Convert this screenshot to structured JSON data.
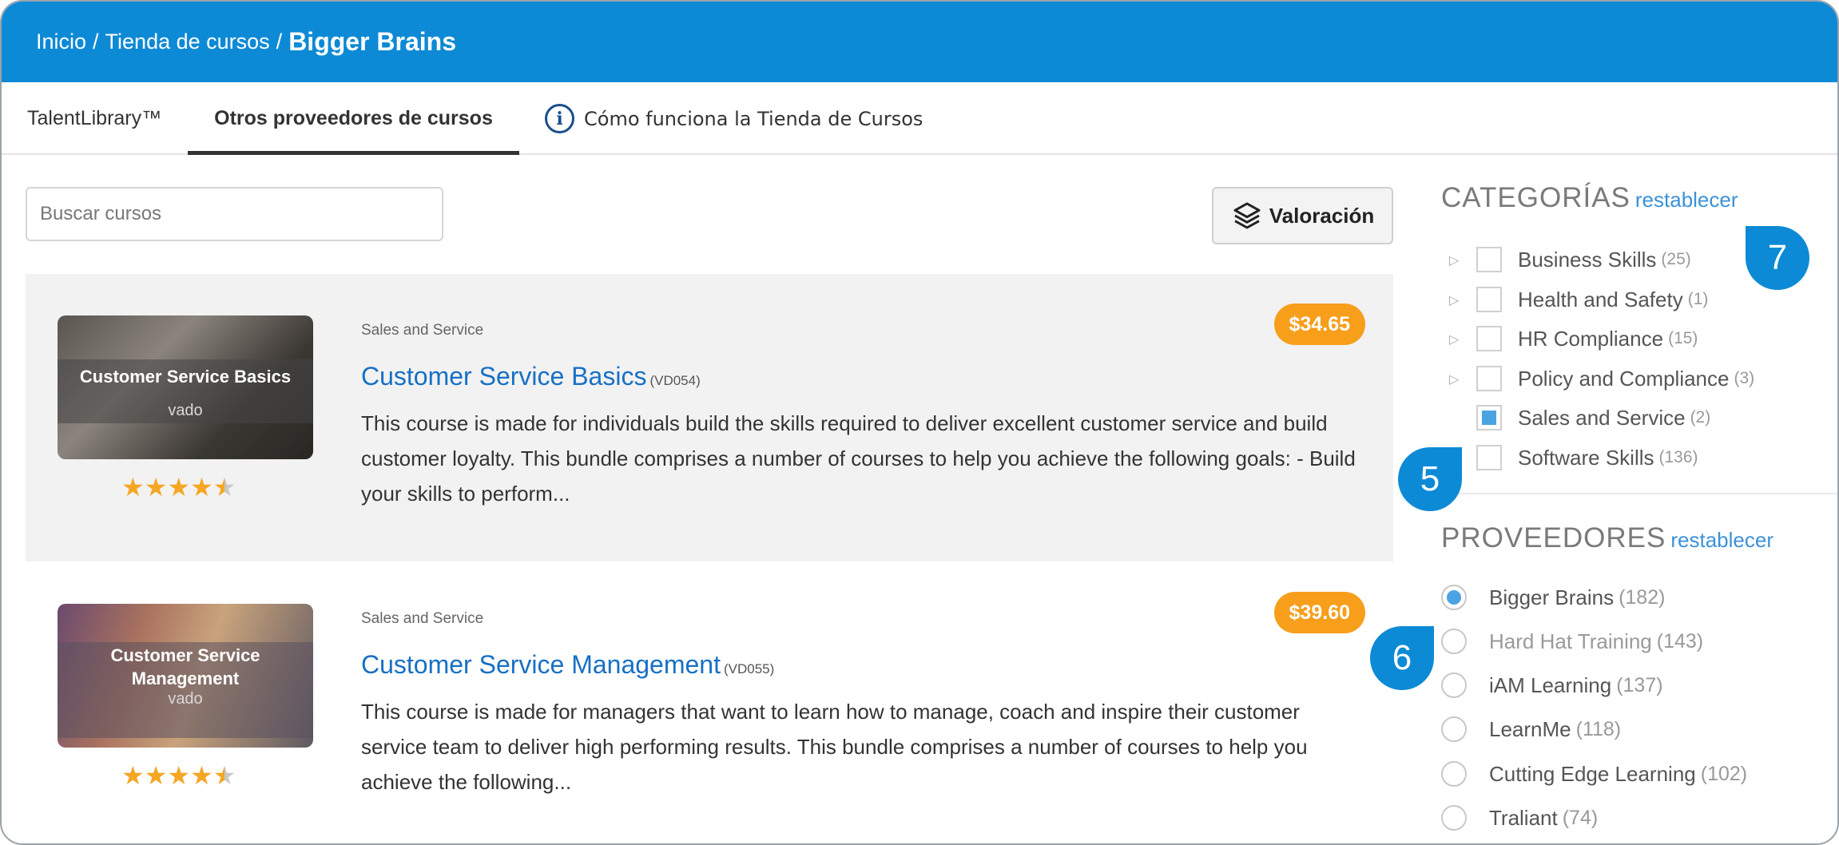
{
  "breadcrumb": {
    "items": [
      "Inicio",
      "Tienda de cursos"
    ],
    "separator": "/",
    "current": "Bigger Brains"
  },
  "tabs": [
    {
      "label": "TalentLibrary™",
      "active": false
    },
    {
      "label": "Otros proveedores de cursos",
      "active": true
    },
    {
      "label": "Cómo funciona la Tienda de Cursos",
      "active": false,
      "icon": "info-icon"
    }
  ],
  "search": {
    "placeholder": "Buscar cursos",
    "value": ""
  },
  "sort": {
    "label": "Valoración",
    "icon": "layers-icon"
  },
  "courses": [
    {
      "category": "Sales and Service",
      "title": "Customer Service Basics",
      "code": "(VD054)",
      "price": "$34.65",
      "thumb_title": "Customer Service Basics",
      "thumb_brand": "vado",
      "rating": 4.5,
      "description": "This course is made for individuals build the skills required to deliver excellent customer service and build customer loyalty. This bundle comprises a number of courses to help you achieve the following goals: - Build your skills to perform..."
    },
    {
      "category": "Sales and Service",
      "title": "Customer Service Management",
      "code": "(VD055)",
      "price": "$39.60",
      "thumb_title": "Customer Service Management",
      "thumb_brand": "vado",
      "rating": 4.5,
      "description": "This course is made for managers that want to learn how to manage, coach and inspire their customer service team to deliver high performing results. This bundle comprises a number of courses to help you achieve the following..."
    }
  ],
  "categories": {
    "heading": "CATEGORÍAS",
    "reset": "restablecer",
    "items": [
      {
        "label": "Business Skills",
        "count": "(25)",
        "checked": false,
        "expandable": true
      },
      {
        "label": "Health and Safety",
        "count": "(1)",
        "checked": false,
        "expandable": true
      },
      {
        "label": "HR Compliance",
        "count": "(15)",
        "checked": false,
        "expandable": true
      },
      {
        "label": "Policy and Compliance",
        "count": "(3)",
        "checked": false,
        "expandable": true
      },
      {
        "label": "Sales and Service",
        "count": "(2)",
        "checked": true,
        "expandable": false
      },
      {
        "label": "Software Skills",
        "count": "(136)",
        "checked": false,
        "expandable": false
      }
    ]
  },
  "providers": {
    "heading": "PROVEEDORES",
    "reset": "restablecer",
    "items": [
      {
        "label": "Bigger Brains",
        "count": "(182)",
        "selected": true
      },
      {
        "label": "Hard Hat Training",
        "count": "(143)",
        "selected": false
      },
      {
        "label": "iAM Learning",
        "count": "(137)",
        "selected": false
      },
      {
        "label": "LearnMe",
        "count": "(118)",
        "selected": false
      },
      {
        "label": "Cutting Edge Learning",
        "count": "(102)",
        "selected": false
      },
      {
        "label": "Traliant",
        "count": "(74)",
        "selected": false
      }
    ]
  },
  "callouts": [
    "7",
    "5",
    "6"
  ],
  "colors": {
    "header": "#0d8ad6",
    "link": "#1770c4",
    "price": "#f79e1b",
    "star": "#f5a623",
    "check": "#4ba3e2"
  }
}
